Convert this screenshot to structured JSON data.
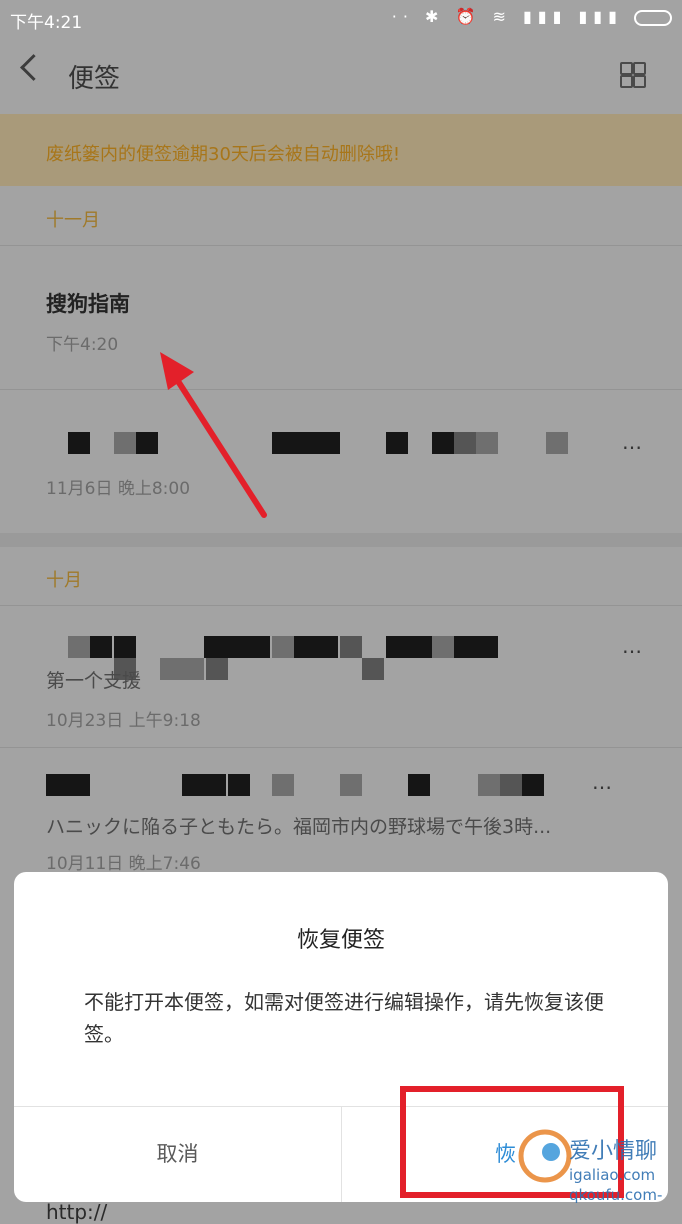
{
  "status_bar": {
    "time": "下午4:21",
    "icons": "·· ✱ ⏰ ≋ ▮▮▮ ▮▮▮"
  },
  "header": {
    "title": "便签"
  },
  "banner": {
    "text": "废纸篓内的便签逾期30天后会被自动删除哦!"
  },
  "sections": [
    {
      "label": "十一月"
    },
    {
      "label": "十月"
    }
  ],
  "notes": [
    {
      "title": "搜狗指南",
      "date": "下午4:20"
    },
    {
      "preview": "…",
      "date": "11月6日 晚上8:00"
    },
    {
      "preview": "第一个支援",
      "date": "10月23日 上午9:18"
    },
    {
      "preview": "ハニックに陥る子ともたら。福岡市内の野球場で午後3時...",
      "date": "10月11日 晚上7:46"
    }
  ],
  "bottom_line": "http://",
  "dialog": {
    "title": "恢复便签",
    "message": "不能打开本便签，如需对便签进行编辑操作，请先恢复该便签。",
    "cancel_label": "取消",
    "restore_label": "恢"
  },
  "watermark": {
    "line1": "爱小情聊",
    "line2": "igaliao.com",
    "line3": "qkoufu.com-"
  },
  "colors": {
    "accent_gold": "#a07a2a",
    "highlight_red": "#e3202a",
    "button_blue": "#2d8cd6"
  }
}
